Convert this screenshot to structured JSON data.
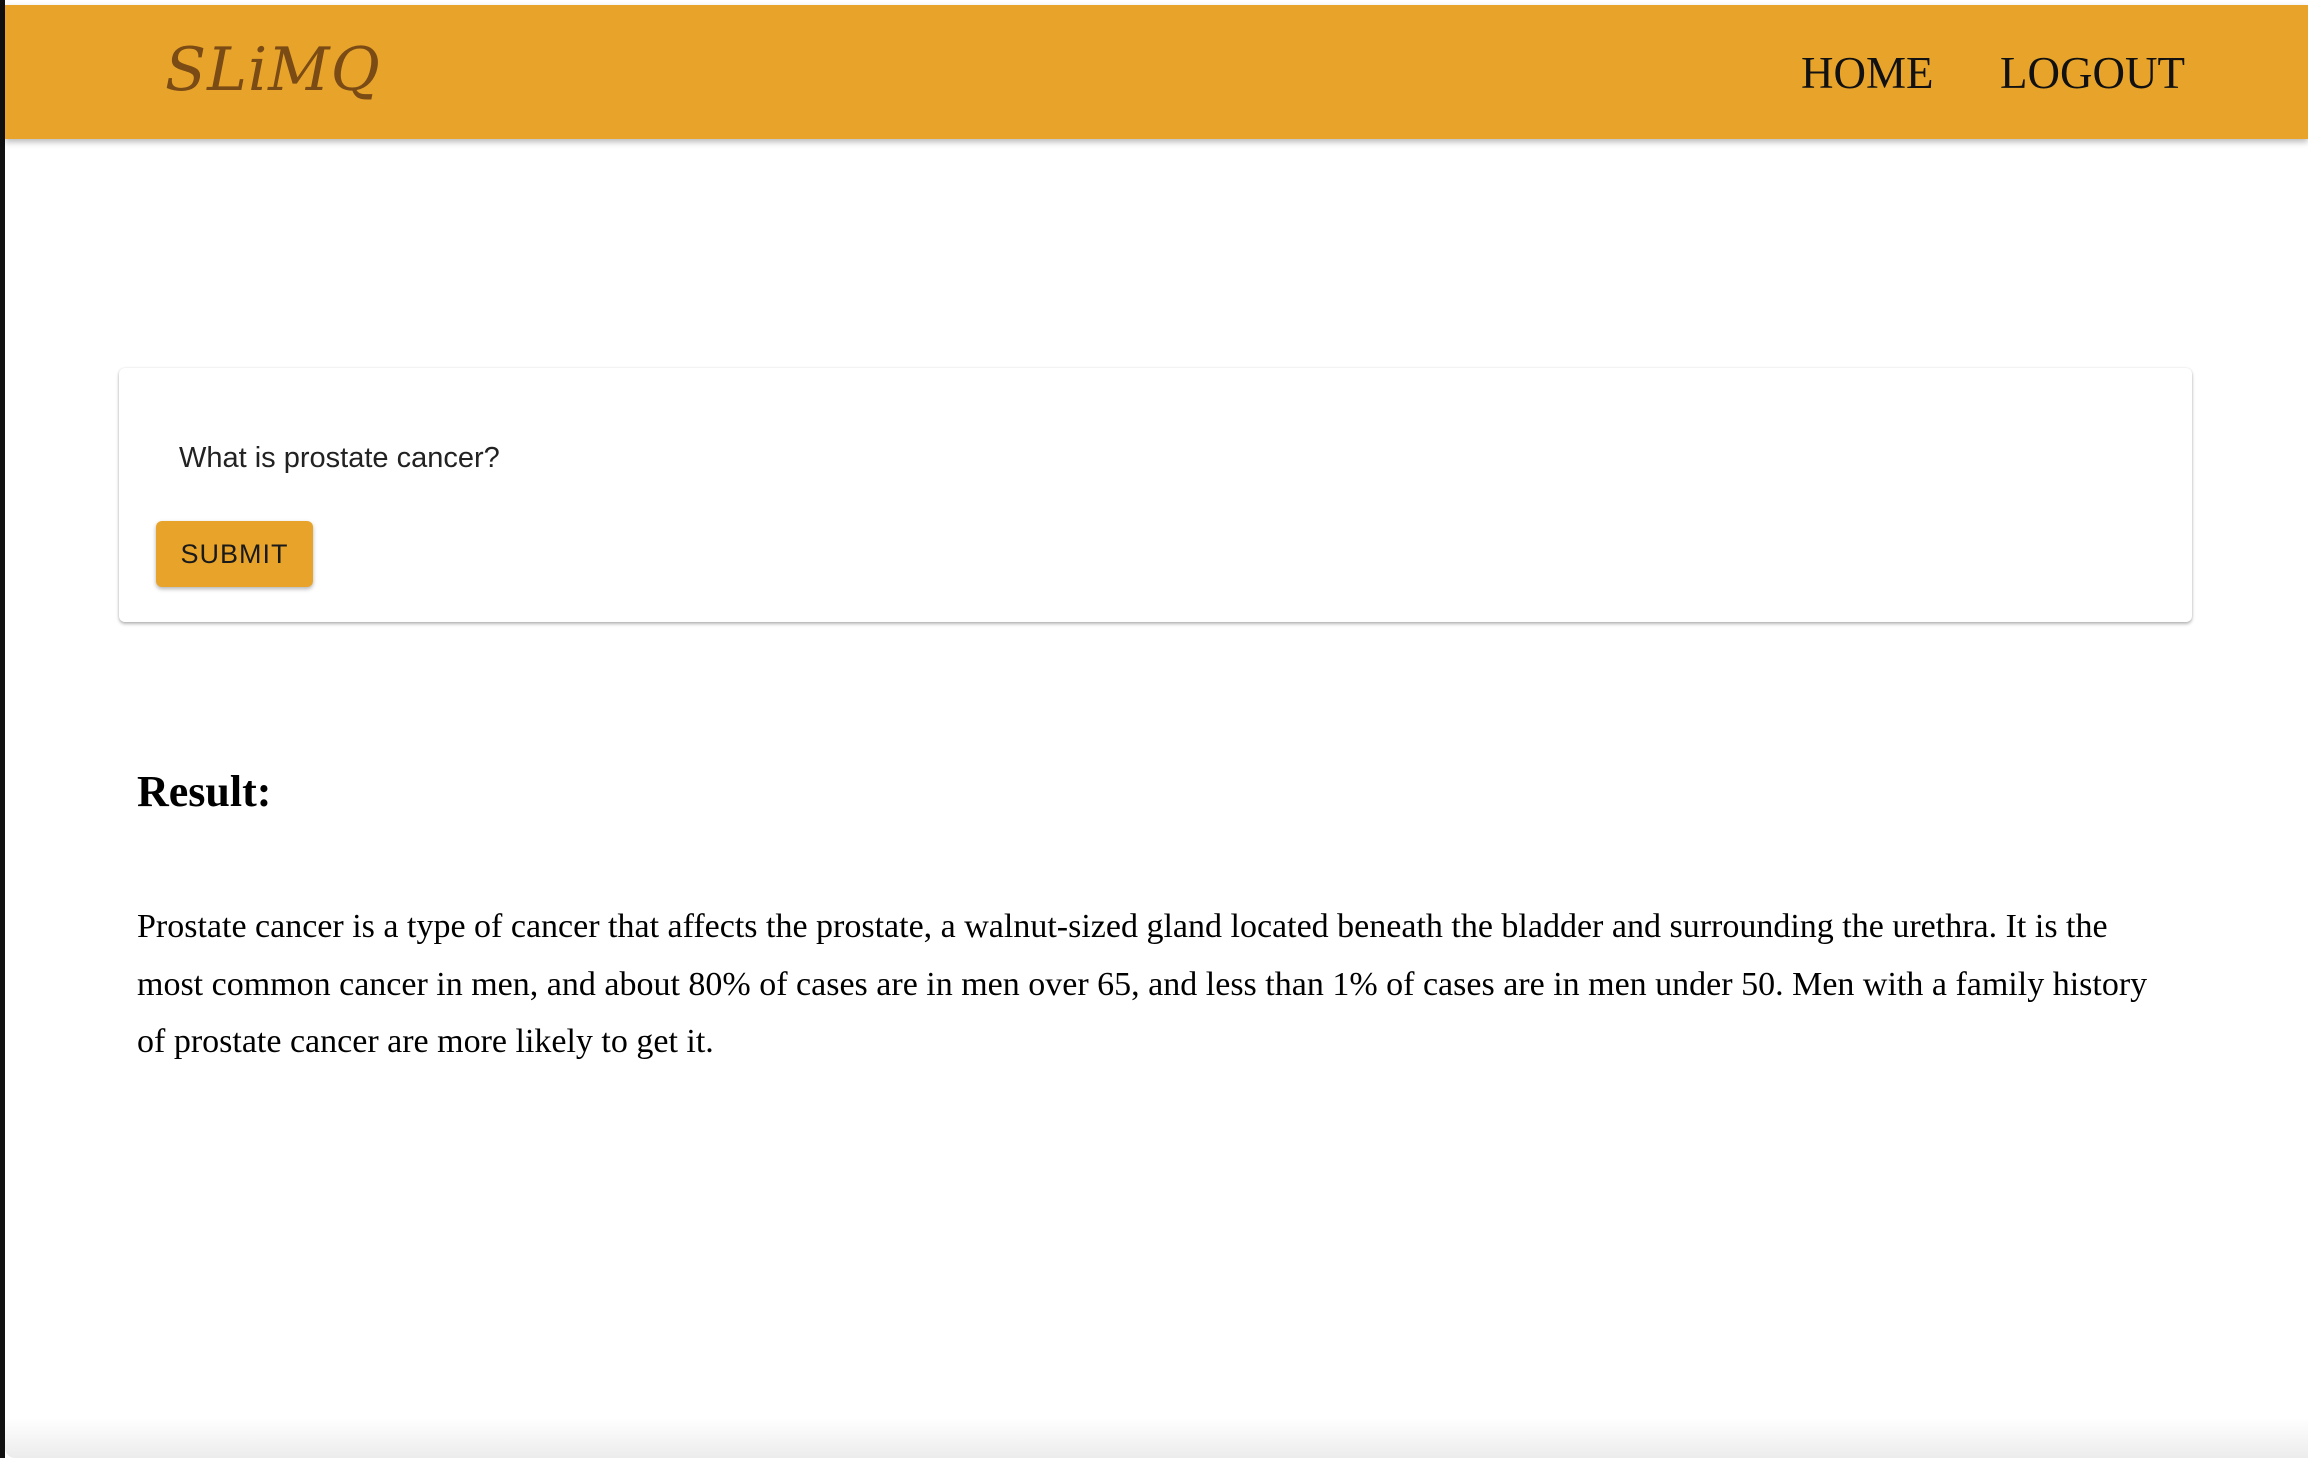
{
  "header": {
    "brand": "SLiMQ",
    "nav": {
      "home_label": "HOME",
      "logout_label": "LOGOUT"
    }
  },
  "query": {
    "value": "What is prostate cancer?",
    "submit_label": "SUBMIT"
  },
  "result": {
    "title": "Result:",
    "text": "Prostate cancer is a type of cancer that affects the prostate, a walnut-sized gland located beneath the bladder and surrounding the urethra. It is the most common cancer in men, and about 80% of cases are in men over 65, and less than 1% of cases are in men under 50. Men with a family history of prostate cancer are more likely to get it."
  },
  "theme": {
    "accent": "#e8a42a",
    "brand_color": "#7a4b14"
  }
}
